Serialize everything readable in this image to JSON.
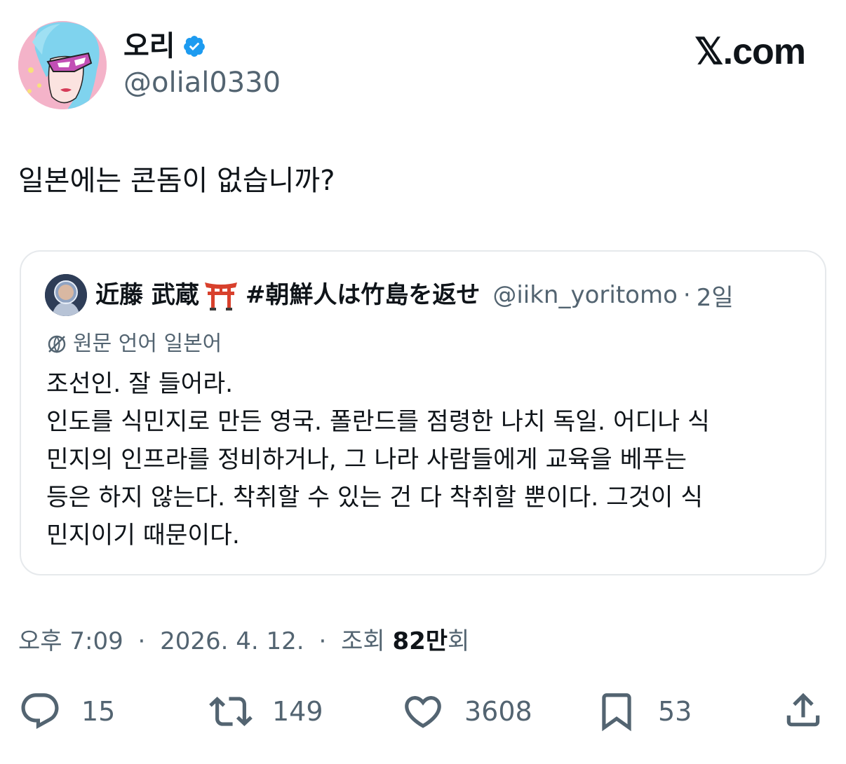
{
  "author": {
    "display_name": "오리",
    "handle": "@olial0330",
    "verified": true
  },
  "brand": "𝕏.com",
  "tweet": {
    "text": "일본에는 콘돔이 없습니까?"
  },
  "quoted": {
    "name": "近藤 武蔵",
    "emoji": "torii-gate-icon",
    "tag": "#朝鮮人は竹島を返せ",
    "handle": "@iikn_yoritomo",
    "dot": "·",
    "time": "2일",
    "translate_label": "원문 언어 일본어",
    "lines": [
      "조선인. 잘 들어라.",
      "인도를 식민지로 만든 영국. 폴란드를 점령한 나치 독일. 어디나 식",
      "민지의 인프라를 정비하거나, 그 나라 사람들에게 교육을 베푸는",
      "등은 하지 않는다. 착취할 수 있는 건 다 착취할 뿐이다. 그것이 식",
      "민지이기 때문이다."
    ]
  },
  "meta": {
    "time": "오후 7:09",
    "sep1": "·",
    "date": "2026. 4. 12.",
    "sep2": "·",
    "views_label": "조회",
    "views_count": "82만",
    "views_suffix": "회"
  },
  "actions": {
    "replies": "15",
    "reposts": "149",
    "likes": "3608",
    "bookmarks": "53"
  },
  "colors": {
    "text": "#0f1419",
    "secondary": "#536471",
    "verified": "#1d9bf0",
    "border": "#e6e9ec"
  }
}
